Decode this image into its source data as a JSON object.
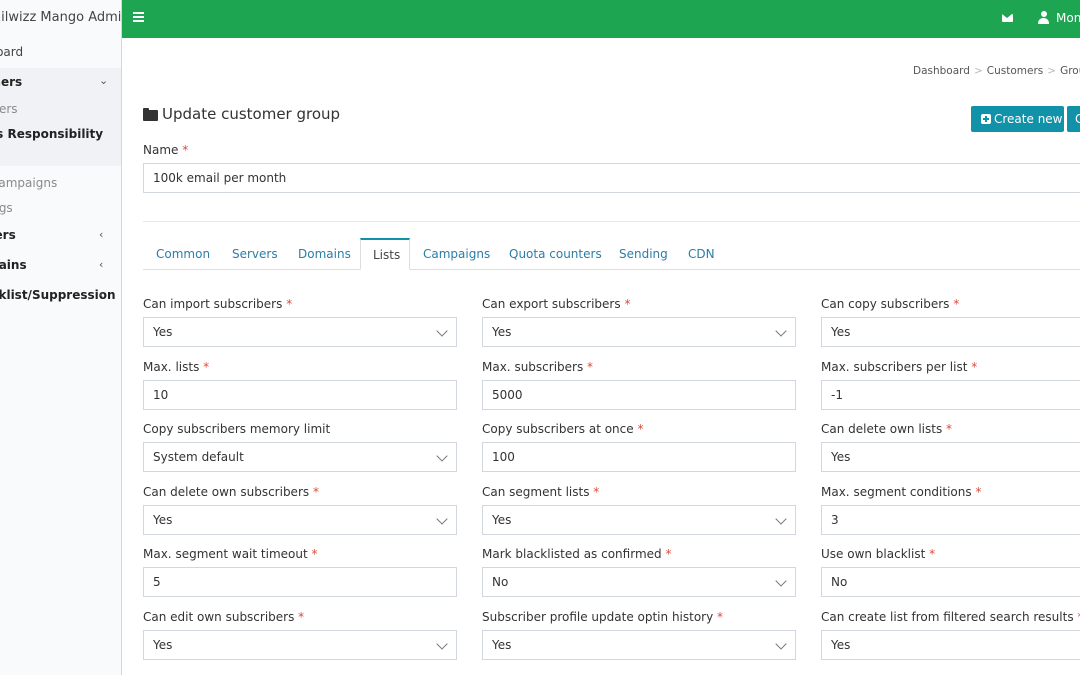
{
  "sidebar": {
    "logo": "Mailwizz Mango Admin",
    "items": [
      {
        "label": "Dashboard"
      },
      {
        "label": "Customers"
      },
      {
        "label": "Customers"
      },
      {
        "label": "Groups Responsibility"
      },
      {
        "label": "Campaigns"
      },
      {
        "label": "Logs"
      },
      {
        "label": "Servers"
      },
      {
        "label": "Domains"
      },
      {
        "label": "Blacklist/Suppression"
      }
    ]
  },
  "topbar": {
    "user_name": "Mongo"
  },
  "breadcrumb": [
    "Dashboard",
    "Customers",
    "Groups"
  ],
  "page": {
    "title": "Update customer group",
    "create_new": "Create new",
    "extra_button": "C"
  },
  "name_field": {
    "label": "Name",
    "value": "100k email per month"
  },
  "tabs": [
    "Common",
    "Servers",
    "Domains",
    "Lists",
    "Campaigns",
    "Quota counters",
    "Sending",
    "CDN"
  ],
  "active_tab": "Lists",
  "fields": [
    {
      "label": "Can import subscribers",
      "required": true,
      "value": "Yes",
      "type": "select"
    },
    {
      "label": "Can export subscribers",
      "required": true,
      "value": "Yes",
      "type": "select"
    },
    {
      "label": "Can copy subscribers",
      "required": true,
      "value": "Yes",
      "type": "select"
    },
    {
      "label": "Max. lists",
      "required": true,
      "value": "10",
      "type": "text"
    },
    {
      "label": "Max. subscribers",
      "required": true,
      "value": "5000",
      "type": "text"
    },
    {
      "label": "Max. subscribers per list",
      "required": true,
      "value": "-1",
      "type": "text"
    },
    {
      "label": "Copy subscribers memory limit",
      "required": false,
      "value": "System default",
      "type": "select"
    },
    {
      "label": "Copy subscribers at once",
      "required": true,
      "value": "100",
      "type": "text"
    },
    {
      "label": "Can delete own lists",
      "required": true,
      "value": "Yes",
      "type": "select"
    },
    {
      "label": "Can delete own subscribers",
      "required": true,
      "value": "Yes",
      "type": "select"
    },
    {
      "label": "Can segment lists",
      "required": true,
      "value": "Yes",
      "type": "select"
    },
    {
      "label": "Max. segment conditions",
      "required": true,
      "value": "3",
      "type": "text"
    },
    {
      "label": "Max. segment wait timeout",
      "required": true,
      "value": "5",
      "type": "text"
    },
    {
      "label": "Mark blacklisted as confirmed",
      "required": true,
      "value": "No",
      "type": "select"
    },
    {
      "label": "Use own blacklist",
      "required": true,
      "value": "No",
      "type": "select"
    },
    {
      "label": "Can edit own subscribers",
      "required": true,
      "value": "Yes",
      "type": "select"
    },
    {
      "label": "Subscriber profile update optin history",
      "required": true,
      "value": "Yes",
      "type": "select"
    },
    {
      "label": "Can create list from filtered search results",
      "required": true,
      "value": "Yes",
      "type": "select"
    }
  ],
  "colors": {
    "topbar": "#1ea552",
    "accent": "#1292a8",
    "link": "#2b7ea6",
    "required": "#dd4b39"
  }
}
